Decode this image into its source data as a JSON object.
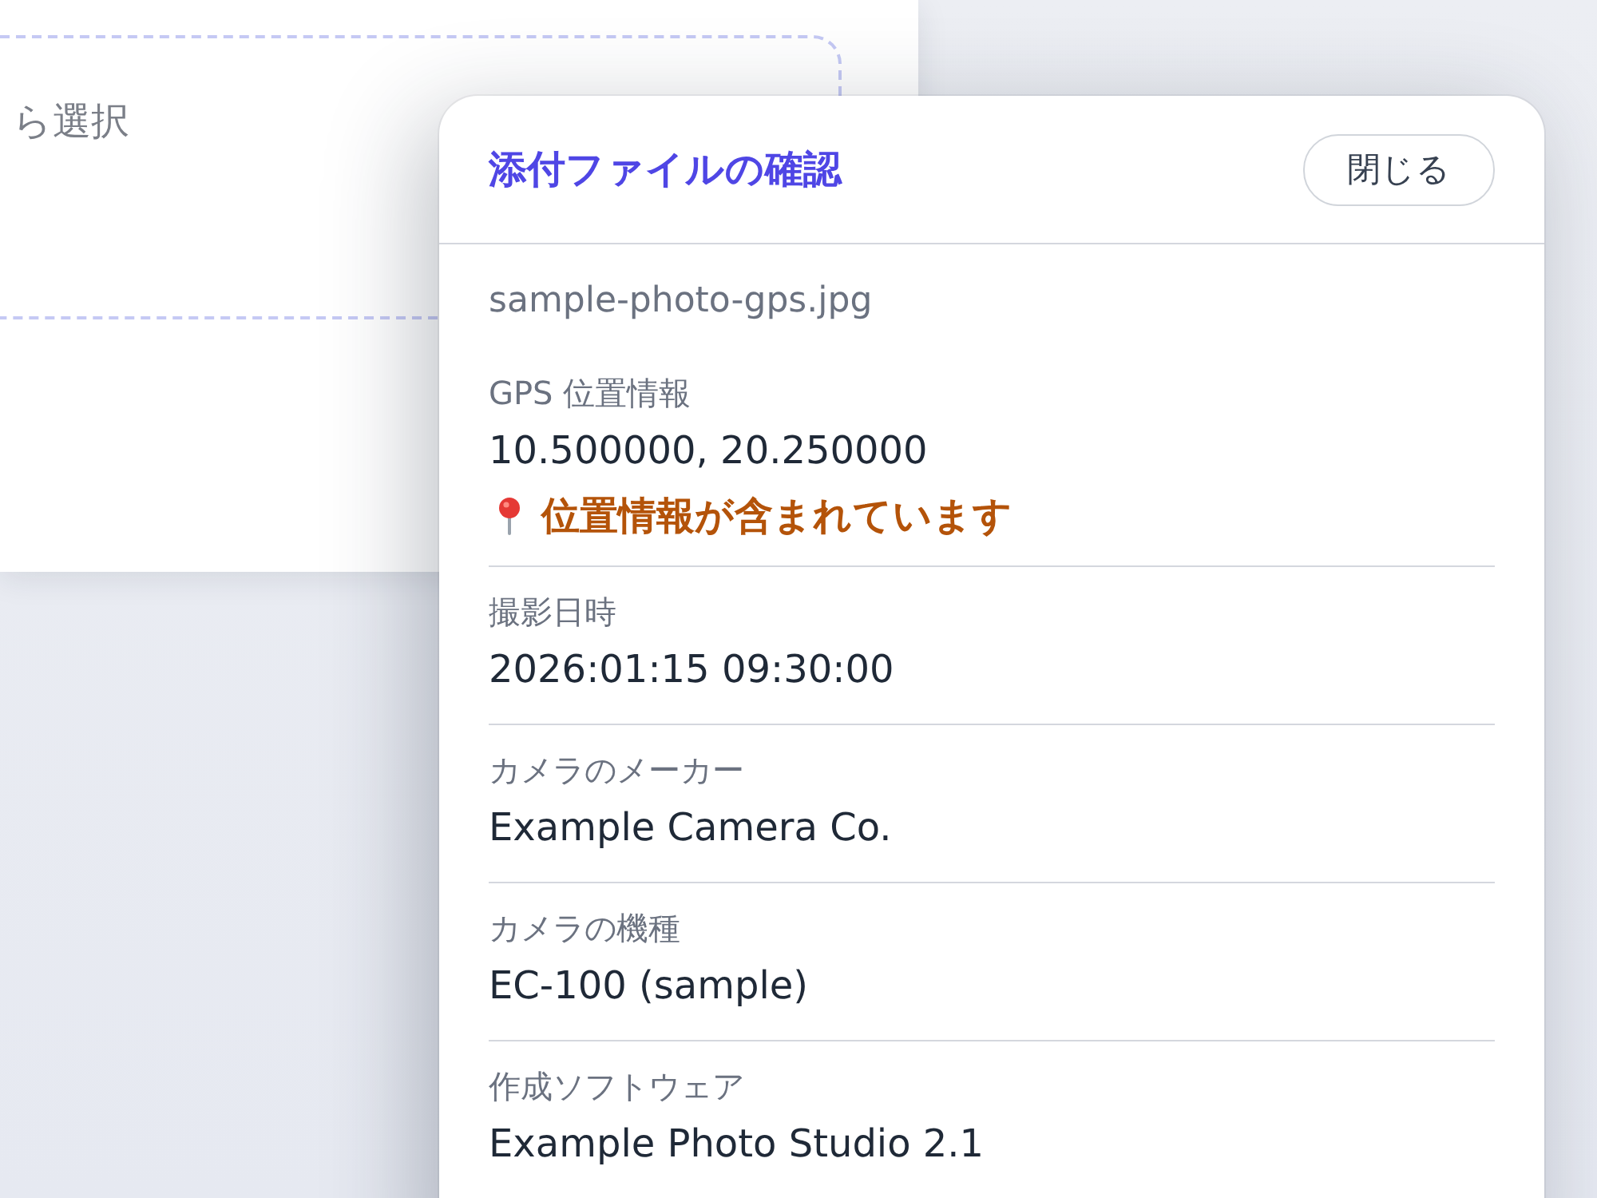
{
  "background_card": {
    "drop_zone": {
      "text": "ら選択"
    }
  },
  "dialog": {
    "title": "添付ファイルの確認",
    "close_button": "閉じる",
    "file_name": "sample-photo-gps.jpg",
    "fields": [
      {
        "label": "GPS 位置情報",
        "value": "10.500000, 20.250000",
        "warning": "位置情報が含まれています"
      },
      {
        "label": "撮影日時",
        "value": "2026:01:15 09:30:00"
      },
      {
        "label": "カメラのメーカー",
        "value": "Example Camera Co."
      },
      {
        "label": "カメラの機種",
        "value": "EC-100 (sample)"
      },
      {
        "label": "作成ソフトウェア",
        "value": "Example Photo Studio 2.1"
      }
    ]
  }
}
